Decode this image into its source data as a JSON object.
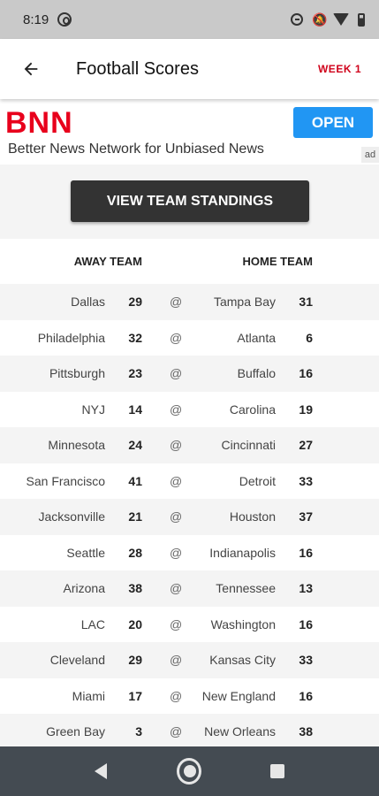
{
  "status_bar": {
    "time": "8:19",
    "icons": [
      "sync-icon",
      "alarm-icon",
      "bell-off-icon",
      "wifi-icon",
      "battery-icon"
    ]
  },
  "app_bar": {
    "title": "Football Scores",
    "week_label": "WEEK 1"
  },
  "ad": {
    "brand": "BNN",
    "tagline": "Better News Network for Unbiased News",
    "open_label": "OPEN",
    "ad_label": "ad"
  },
  "standings_button": "VIEW TEAM STANDINGS",
  "table": {
    "headers": {
      "away": "AWAY TEAM",
      "home": "HOME TEAM"
    },
    "separator": "@",
    "games": [
      {
        "away_team": "Dallas",
        "away_score": "29",
        "home_team": "Tampa Bay",
        "home_score": "31"
      },
      {
        "away_team": "Philadelphia",
        "away_score": "32",
        "home_team": "Atlanta",
        "home_score": "6"
      },
      {
        "away_team": "Pittsburgh",
        "away_score": "23",
        "home_team": "Buffalo",
        "home_score": "16"
      },
      {
        "away_team": "NYJ",
        "away_score": "14",
        "home_team": "Carolina",
        "home_score": "19"
      },
      {
        "away_team": "Minnesota",
        "away_score": "24",
        "home_team": "Cincinnati",
        "home_score": "27"
      },
      {
        "away_team": "San Francisco",
        "away_score": "41",
        "home_team": "Detroit",
        "home_score": "33"
      },
      {
        "away_team": "Jacksonville",
        "away_score": "21",
        "home_team": "Houston",
        "home_score": "37"
      },
      {
        "away_team": "Seattle",
        "away_score": "28",
        "home_team": "Indianapolis",
        "home_score": "16"
      },
      {
        "away_team": "Arizona",
        "away_score": "38",
        "home_team": "Tennessee",
        "home_score": "13"
      },
      {
        "away_team": "LAC",
        "away_score": "20",
        "home_team": "Washington",
        "home_score": "16"
      },
      {
        "away_team": "Cleveland",
        "away_score": "29",
        "home_team": "Kansas City",
        "home_score": "33"
      },
      {
        "away_team": "Miami",
        "away_score": "17",
        "home_team": "New England",
        "home_score": "16"
      },
      {
        "away_team": "Green Bay",
        "away_score": "3",
        "home_team": "New Orleans",
        "home_score": "38"
      }
    ]
  },
  "colors": {
    "accent_red": "#d0021b",
    "brand_red": "#e8001c",
    "open_blue": "#2196f3",
    "button_dark": "#333333"
  }
}
